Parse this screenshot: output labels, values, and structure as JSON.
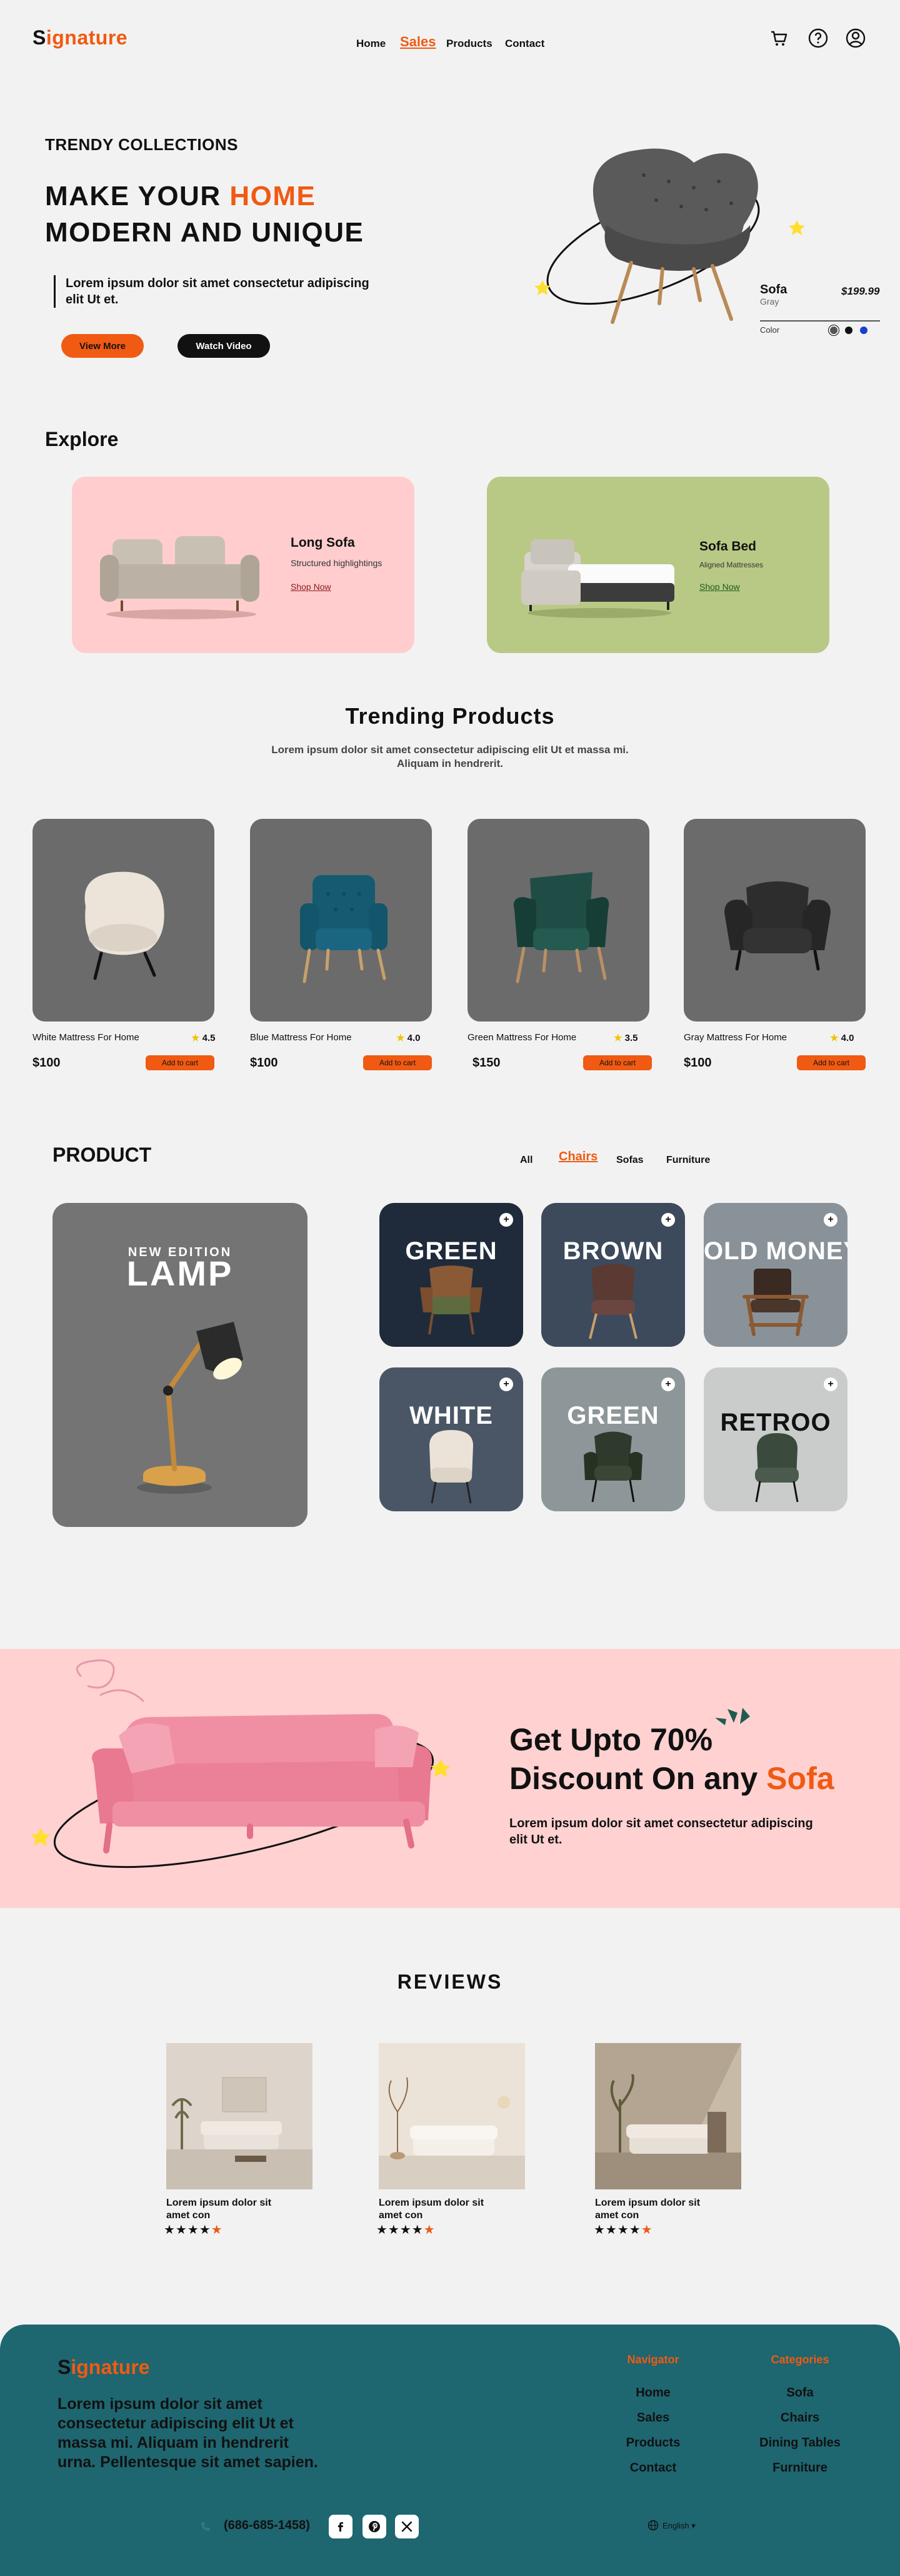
{
  "header": {
    "logo_first": "S",
    "logo_rest": "ignature",
    "nav": [
      "Home",
      "Sales",
      "Products",
      "Contact"
    ],
    "active_nav": "Sales"
  },
  "hero": {
    "kicker": "TRENDY COLLECTIONS",
    "title_1": "MAKE YOUR ",
    "title_highlight": "HOME",
    "title_2": "MODERN AND UNIQUE",
    "description": "Lorem ipsum dolor sit amet consectetur adipiscing elit Ut et.",
    "primary_button": "View More",
    "secondary_button": "Watch Video",
    "product": {
      "name": "Sofa",
      "color": "Gray",
      "price": "$199.99",
      "color_label": "Color",
      "swatches": [
        "#555555",
        "#111111",
        "#1a3fd1"
      ]
    }
  },
  "explore": {
    "title": "Explore",
    "cards": [
      {
        "name": "Long Sofa",
        "subtitle": "Structured highlightings",
        "link": "Shop Now",
        "bg": "#ffcdcd"
      },
      {
        "name": "Sofa Bed",
        "subtitle": "Aligned Mattresses",
        "link": "Shop Now",
        "bg": "#b8c985"
      }
    ]
  },
  "trending": {
    "title": "Trending Products",
    "description": "Lorem ipsum dolor sit amet consectetur adipiscing elit Ut et massa mi. Aliquam in hendrerit.",
    "cart_label": "Add to cart",
    "products": [
      {
        "name": "White Mattress For Home",
        "rating": "4.5",
        "price": "$100"
      },
      {
        "name": "Blue Mattress For Home",
        "rating": "4.0",
        "price": "$100"
      },
      {
        "name": "Green Mattress For Home",
        "rating": "3.5",
        "price": "$150"
      },
      {
        "name": "Gray Mattress For Home",
        "rating": "4.0",
        "price": "$100"
      }
    ]
  },
  "product": {
    "title": "PRODUCT",
    "tabs": [
      "All",
      "Chairs",
      "Sofas",
      "Furniture"
    ],
    "active_tab": "Chairs",
    "feature": {
      "kicker": "NEW EDITION",
      "name": "LAMP"
    },
    "cards": [
      {
        "label": "GREEN",
        "bg": "#1f2b3a"
      },
      {
        "label": "BROWN",
        "bg": "#3d4a5c"
      },
      {
        "label": "OLD MONEY",
        "bg": "#8a9299"
      },
      {
        "label": "WHITE",
        "bg": "#4a5666"
      },
      {
        "label": "GREEN",
        "bg": "#8d9698"
      },
      {
        "label": "RETROO",
        "bg": "#c9cccb"
      }
    ]
  },
  "promo": {
    "title_1": "Get Upto 70%",
    "title_2": "Discount On any ",
    "title_highlight": "Sofa",
    "description": "Lorem ipsum dolor sit amet consectetur adipiscing elit Ut et."
  },
  "reviews": {
    "title": "REVIEWS",
    "items": [
      {
        "text": "Lorem ipsum dolor sit amet con",
        "stars": "★★★★",
        "half": "★"
      },
      {
        "text": "Lorem ipsum dolor sit amet con",
        "stars": "★★★★",
        "half": "★"
      },
      {
        "text": "Lorem ipsum dolor sit amet con",
        "stars": "★★★★",
        "half": "★"
      }
    ]
  },
  "footer": {
    "logo_first": "S",
    "logo_rest": "ignature",
    "description": "Lorem ipsum dolor sit amet consectetur adipiscing elit Ut et massa mi. Aliquam in hendrerit urna. Pellentesque sit amet sapien.",
    "navigator_title": "Navigator",
    "navigator": [
      "Home",
      "Sales",
      "Products",
      "Contact"
    ],
    "categories_title": "Categories",
    "categories": [
      "Sofa",
      "Chairs",
      "Dining Tables",
      "Furniture"
    ],
    "phone": "(686-685-1458)",
    "language": "English"
  },
  "colors": {
    "accent": "#f05a12",
    "footer": "#1e6670",
    "promo_bg": "#ffd1d1"
  }
}
